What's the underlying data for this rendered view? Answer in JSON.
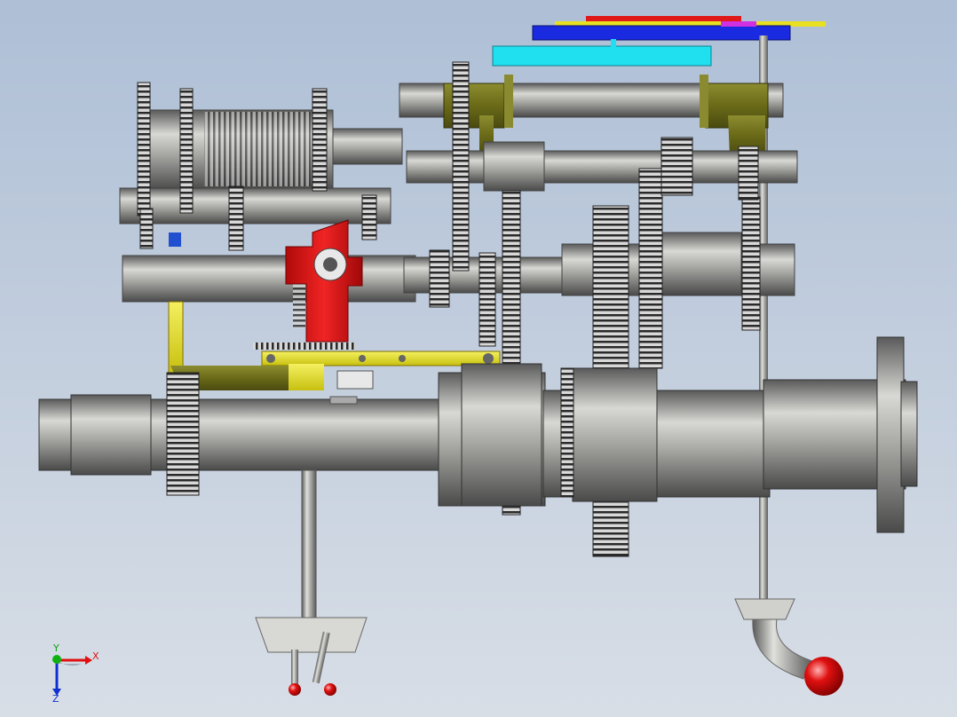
{
  "viewport": {
    "background_top": "#aebfd6",
    "background_bottom": "#d8dee6"
  },
  "triad": {
    "x_label": "X",
    "y_label": "Y",
    "z_label": "Z",
    "x_color": "#e01010",
    "y_color": "#10b010",
    "z_color": "#1030d0"
  },
  "palette": {
    "shaft": "#8a8a8a",
    "gear": "#7a7a7a",
    "yellow_part": "#e8e020",
    "olive_part": "#7a7a20",
    "red_part": "#e01818",
    "cyan_part": "#20e0f0",
    "blue_part": "#1a2ae0",
    "knob": "#e01010"
  },
  "icons": [
    "coordinate-triad-icon"
  ]
}
